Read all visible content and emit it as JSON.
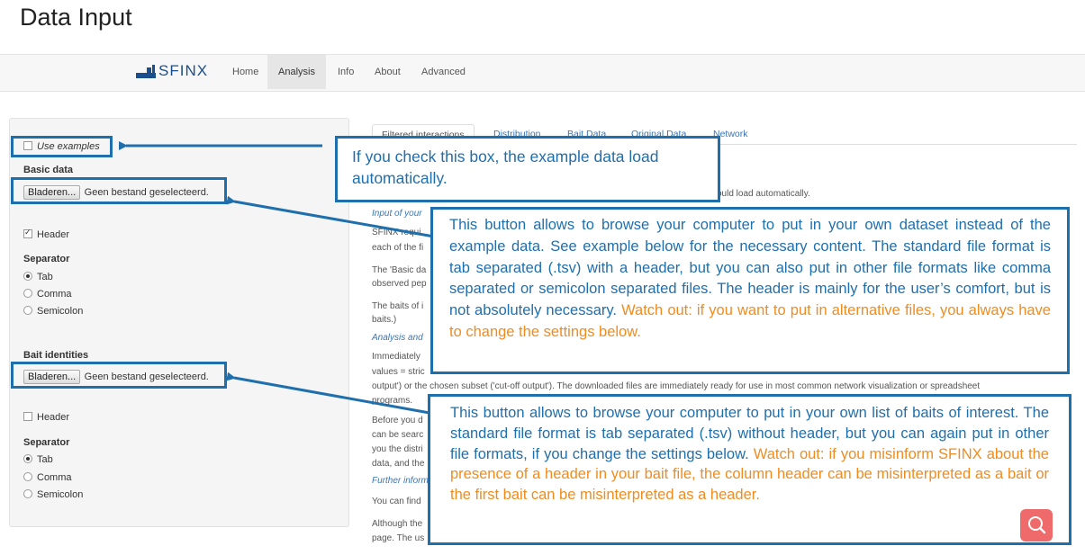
{
  "page": {
    "title": "Data Input"
  },
  "nav": {
    "logo_text": "SFINX",
    "items": [
      "Home",
      "Analysis",
      "Info",
      "About",
      "Advanced"
    ],
    "active": "Analysis"
  },
  "sidebar": {
    "use_examples": {
      "label": "Use examples",
      "checked": false
    },
    "basic_data": {
      "heading": "Basic data",
      "browse_label": "Bladeren...",
      "file_status": "Geen bestand geselecteerd.",
      "header_label": "Header",
      "header_checked": true,
      "separator_heading": "Separator",
      "options": [
        "Tab",
        "Comma",
        "Semicolon"
      ],
      "selected": "Tab"
    },
    "bait_identities": {
      "heading": "Bait identities",
      "browse_label": "Bladeren...",
      "file_status": "Geen bestand geselecteerd.",
      "header_label": "Header",
      "header_checked": false,
      "separator_heading": "Separator",
      "options": [
        "Tab",
        "Comma",
        "Semicolon"
      ],
      "selected": "Tab"
    }
  },
  "tabs": [
    "Filtered interactions",
    "Distribution",
    "Bait Data",
    "Original Data",
    "Network"
  ],
  "active_tab": "Filtered interactions",
  "main": {
    "l1": "ould load automatically.",
    "l2": "Input of your",
    "l3": "SFINX requi",
    "l4": "each of the fi",
    "l5": "The 'Basic da",
    "l6": "observed pep",
    "l7": "The baits of i",
    "l8": "baits.)",
    "l9": "Analysis and",
    "l10": "Immediately",
    "l11": "values = stric",
    "l12": "output') or the chosen subset ('cut-off output'). The downloaded files are immediately ready for use in most common network visualization or spreadsheet",
    "l13": "programs.",
    "l14": "Before you d",
    "l15": "can be searc",
    "l16": "you the distri",
    "l17": "data, and the",
    "l18": "Further inform",
    "l19": "You can find",
    "l20": "Although the",
    "l21": "page. The us"
  },
  "callouts": {
    "c1": "If you check this box, the example data load automatically.",
    "c2_blue": "This button allows to browse your computer to put in your own dataset instead of the example data. See example below for the necessary content. The standard file format is tab separated (.tsv) with a header, but you can also put in other file formats like comma separated or semicolon separated files. The header is mainly for the user’s comfort, but is not absolutely necessary.",
    "c2_orange": "Watch out: if you want to put in alternative files, you always have to change the settings below.",
    "c3_blue": "This button allows to browse your computer to put in your own list of baits of interest. The standard file format is tab separated (.tsv) without header, but you can again put in other file formats, if you change the settings below.",
    "c3_orange": "Watch out: if you misinform SFINX about the presence of a header in your bait file, the column header can be misinterpreted as a bait or the first bait can be misinterpreted as a header."
  },
  "colors": {
    "annotation": "#1f6fad",
    "warning": "#f08c1e",
    "search_button": "#ef6b6b"
  },
  "icons": [
    "search-icon",
    "arrow-icon"
  ]
}
